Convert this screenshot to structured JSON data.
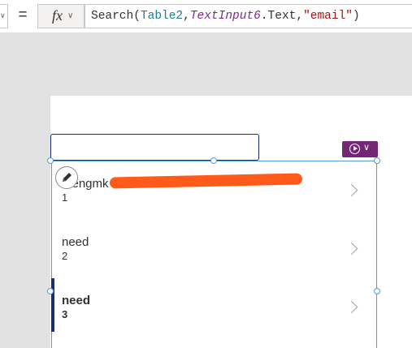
{
  "formula_bar": {
    "equals": "=",
    "fx_label": "fx",
    "chevron": "∨",
    "formula_tokens": {
      "fn": "Search(",
      "table": "Table2",
      "comma1": ",",
      "control": "TextInput6",
      "prop": ".Text,",
      "string": "\"email\"",
      "close": ")"
    }
  },
  "search_input": {
    "value": ""
  },
  "app_button": {
    "icon": "power-apps-icon",
    "chevron": "∨"
  },
  "gallery": {
    "items": [
      {
        "title": "mengmk",
        "subtitle": "1",
        "redacted": true
      },
      {
        "title": "need",
        "subtitle": "2"
      },
      {
        "title": "need",
        "subtitle": "3",
        "selected": true
      }
    ]
  },
  "colors": {
    "accent": "#742774",
    "selection": "#1b2f6e",
    "handle_outline": "#5a9bd4",
    "redaction": "#ff5a1a"
  }
}
